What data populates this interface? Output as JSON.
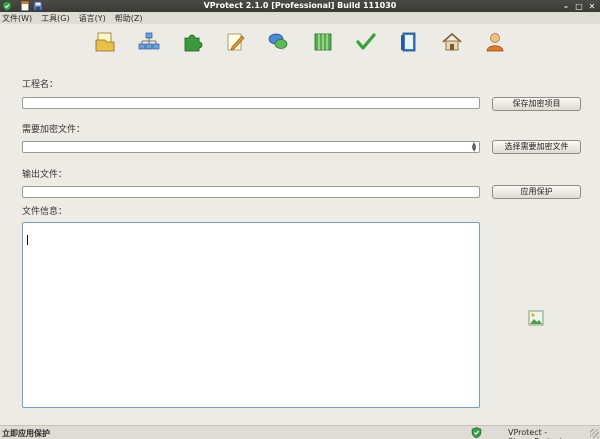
{
  "window": {
    "title": "VProtect 2.1.0 [Professional] Build 111030",
    "controls": {
      "minimize": "–",
      "maximize": "□",
      "close": "✕"
    }
  },
  "menu": [
    "文件(W)",
    "工具(G)",
    "语言(Y)",
    "帮助(Z)"
  ],
  "toolbar_icons": [
    "open-project-icon",
    "network-icon",
    "plugin-icon",
    "edit-icon",
    "chat-icon",
    "grid-icon",
    "check-icon",
    "book-icon",
    "home-icon",
    "user-icon"
  ],
  "form": {
    "project_name_label": "工程名：",
    "project_name_value": "",
    "save_button": "保存加密项目",
    "encrypt_file_label": "需要加密文件：",
    "encrypt_file_value": "",
    "select_file_button": "选择需要加密文件",
    "output_file_label": "输出文件：",
    "output_file_value": "",
    "apply_button": "应用保护",
    "file_info_label": "文件信息：",
    "file_info_value": ""
  },
  "status": {
    "left": "立即应用保护",
    "right": "VProtect - StrongProtect"
  },
  "colors": {
    "titlebar": "#3f3f3c",
    "window_bg": "#edebe6",
    "accent_border": "#7a9cc2"
  }
}
